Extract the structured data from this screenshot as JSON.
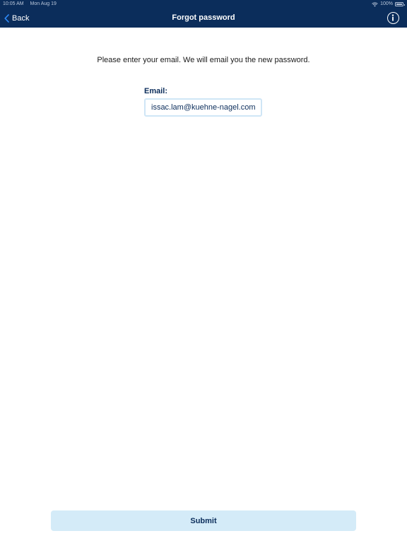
{
  "status_bar": {
    "time": "10:05 AM",
    "date": "Mon Aug 19",
    "battery": "100%"
  },
  "nav": {
    "back_label": "Back",
    "title": "Forgot password"
  },
  "form": {
    "instructions": "Please enter your email. We will email you the new password.",
    "email_label": "Email:",
    "email_value": "issac.lam@kuehne-nagel.com",
    "submit_label": "Submit"
  },
  "colors": {
    "header": "#0b2d5b",
    "input_border": "#cfe6f6",
    "button_bg": "#d4ebf8",
    "back_accent": "#2f8dff"
  },
  "icons": {
    "back": "chevron-left-icon",
    "info": "info-icon",
    "wifi": "wifi-icon",
    "battery": "battery-icon"
  }
}
